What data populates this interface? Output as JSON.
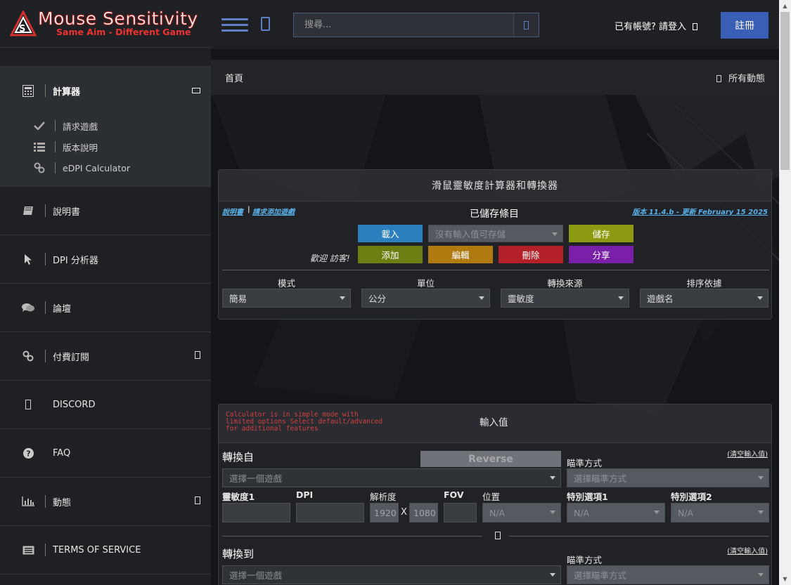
{
  "brand": {
    "title": "Mouse Sensitivity",
    "tagline": "Same Aim - Different Game",
    "accent": "#d32f2f"
  },
  "sidebar": {
    "head": {
      "icon": "calculator-icon",
      "label": "計算器"
    },
    "sub_items": [
      {
        "icon": "check-icon",
        "label": "請求遊戲"
      },
      {
        "icon": "list-icon",
        "label": "版本說明"
      },
      {
        "icon": "link-icon",
        "label": "eDPI Calculator"
      }
    ],
    "items": [
      {
        "icon": "book-icon",
        "label": "說明書"
      },
      {
        "icon": "pointer-icon",
        "label": "DPI 分析器"
      },
      {
        "icon": "comments-icon",
        "label": "論壇"
      },
      {
        "icon": "link-icon",
        "label": "付費訂閱"
      },
      {
        "icon": "discord-icon",
        "label": "DISCORD"
      },
      {
        "icon": "question-icon",
        "label": "FAQ"
      },
      {
        "icon": "chart-icon",
        "label": "動態"
      },
      {
        "icon": "document-icon",
        "label": "TERMS OF SERVICE"
      }
    ]
  },
  "header": {
    "search_placeholder": "搜尋...",
    "login_label": "已有帳號? 請登入",
    "register_label": "註冊",
    "register_color": "#3a5db6"
  },
  "breadcrumb": {
    "home": "首頁",
    "feed": "所有動態"
  },
  "calculator": {
    "title": "滑鼠靈敏度計算器和轉換器",
    "manual_link": "說明書",
    "request_link": "請求添加遊戲",
    "version_link": "版本 11.4.b - 更新 February 15 2025",
    "saved_title": "已儲存條目",
    "load_button": "載入",
    "saved_select": "沒有輸入值可存儲",
    "save_button": "儲存",
    "welcome": "歡迎 訪客!",
    "add_button": "添加",
    "edit_button": "編輯",
    "delete_button": "刪除",
    "share_button": "分享",
    "filters": [
      {
        "label": "模式",
        "value": "簡易"
      },
      {
        "label": "單位",
        "value": "公分"
      },
      {
        "label": "轉換來源",
        "value": "靈敏度"
      },
      {
        "label": "排序依據",
        "value": "遊戲名"
      }
    ]
  },
  "inputs": {
    "warning": "Calculator is in simple mode with limited options Select default/advanced for additional features",
    "title": "輸入值",
    "from_title": "轉換自",
    "to_title": "轉換到",
    "reverse_button": "Reverse",
    "clear_link": "(清空輸入值)",
    "aim_label": "瞄準方式",
    "game_placeholder": "選擇一個遊戲",
    "aim_placeholder": "選擇瞄準方式",
    "sens_label": "靈敏度1",
    "dpi_label": "DPI",
    "res_label": "解析度",
    "fov_label": "FOV",
    "location_label": "位置",
    "special1_label": "特別選項1",
    "special2_label": "特別選項2",
    "res_width": "1920",
    "res_height": "1080",
    "x_symbol": "X",
    "na": "N/A"
  }
}
